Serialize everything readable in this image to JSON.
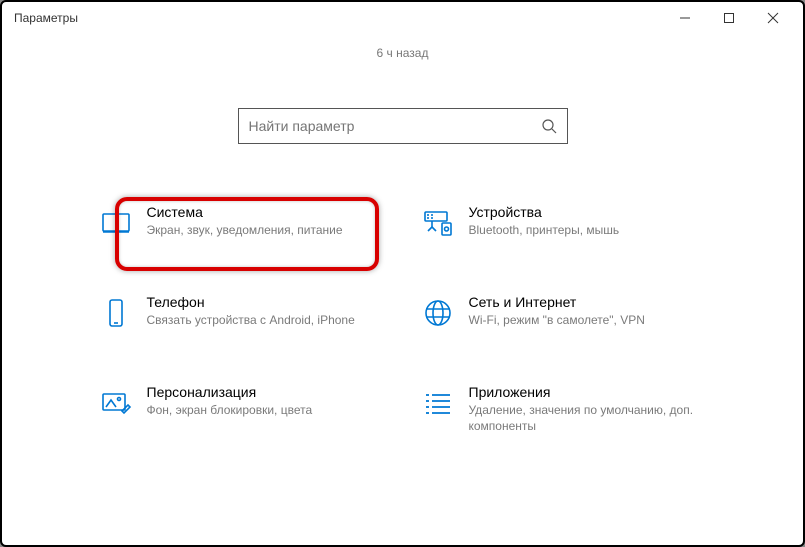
{
  "window": {
    "title": "Параметры"
  },
  "subtitle": "6 ч назад",
  "search": {
    "placeholder": "Найти параметр"
  },
  "tiles": {
    "system": {
      "title": "Система",
      "desc": "Экран, звук, уведомления, питание"
    },
    "devices": {
      "title": "Устройства",
      "desc": "Bluetooth, принтеры, мышь"
    },
    "phone": {
      "title": "Телефон",
      "desc": "Связать устройства с Android, iPhone"
    },
    "network": {
      "title": "Сеть и Интернет",
      "desc": "Wi-Fi, режим \"в самолете\", VPN"
    },
    "personal": {
      "title": "Персонализация",
      "desc": "Фон, экран блокировки, цвета"
    },
    "apps": {
      "title": "Приложения",
      "desc": "Удаление, значения по умолчанию, доп. компоненты"
    }
  }
}
